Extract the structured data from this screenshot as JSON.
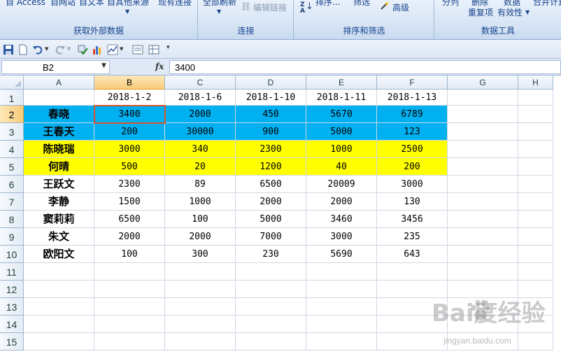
{
  "ribbon": {
    "top_items": {
      "access": "自 Access",
      "web": "自网站",
      "text": "自文本",
      "other": "自其他来源",
      "existing": "现有连接",
      "refresh_all": "全部刷新",
      "edit_links": "编辑链接",
      "sort": "排序...",
      "filter": "筛选",
      "advanced": "高级",
      "split": "分列",
      "remove_dup": "删除",
      "remove_dup2": "重复项",
      "validation": "数据",
      "validation2": "有效性",
      "merge": "合并计算"
    },
    "groups": {
      "external": "获取外部数据",
      "connections": "连接",
      "sort_filter": "排序和筛选",
      "data_tools": "数据工具"
    }
  },
  "formula_bar": {
    "name_box": "B2",
    "fx_label": "fx",
    "formula": "3400"
  },
  "columns": [
    "A",
    "B",
    "C",
    "D",
    "E",
    "F",
    "G",
    "H"
  ],
  "rows": [
    "1",
    "2",
    "3",
    "4",
    "5",
    "6",
    "7",
    "8",
    "9",
    "10",
    "11",
    "12",
    "13",
    "14",
    "15"
  ],
  "sheet": {
    "header": [
      "",
      "2018-1-2",
      "2018-1-6",
      "2018-1-10",
      "2018-1-11",
      "2018-1-13"
    ],
    "records": [
      {
        "name": "春晓",
        "values": [
          "3400",
          "2000",
          "450",
          "5670",
          "6789"
        ],
        "fill": "#00b0f0"
      },
      {
        "name": "王春天",
        "values": [
          "200",
          "30000",
          "900",
          "5000",
          "123"
        ],
        "fill": "#00b0f0"
      },
      {
        "name": "陈晓瑞",
        "values": [
          "3000",
          "340",
          "2300",
          "1000",
          "2500"
        ],
        "fill": "#ffff00"
      },
      {
        "name": "何晴",
        "values": [
          "500",
          "20",
          "1200",
          "40",
          "200"
        ],
        "fill": "#ffff00"
      },
      {
        "name": "王跃文",
        "values": [
          "2300",
          "89",
          "6500",
          "20009",
          "3000"
        ],
        "fill": ""
      },
      {
        "name": "李静",
        "values": [
          "1500",
          "1000",
          "2000",
          "2000",
          "130"
        ],
        "fill": ""
      },
      {
        "name": "窦莉莉",
        "values": [
          "6500",
          "100",
          "5000",
          "3460",
          "3456"
        ],
        "fill": ""
      },
      {
        "name": "朱文",
        "values": [
          "2000",
          "2000",
          "7000",
          "3000",
          "235"
        ],
        "fill": ""
      },
      {
        "name": "欧阳文",
        "values": [
          "100",
          "300",
          "230",
          "5690",
          "643"
        ],
        "fill": ""
      }
    ]
  },
  "selection": {
    "column": "B",
    "row": "2"
  },
  "watermark": {
    "text": "Bai度经验",
    "url": "jingyan.baidu.com"
  }
}
